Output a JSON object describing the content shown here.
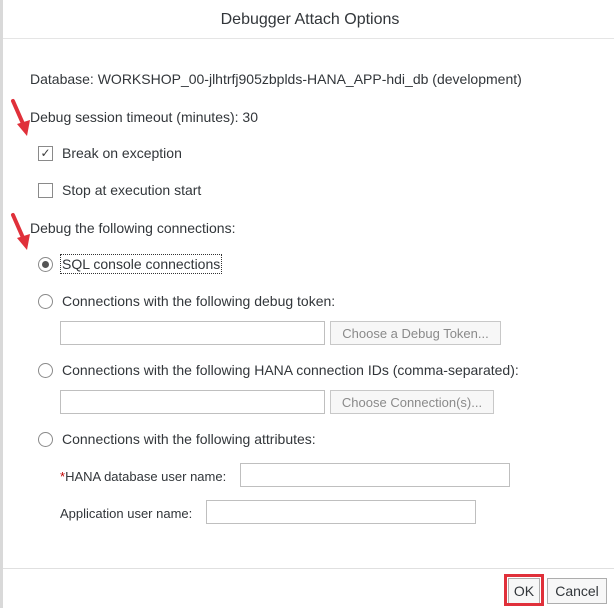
{
  "dialog": {
    "title": "Debugger Attach Options",
    "database_text": "Database: WORKSHOP_00-jlhtrfj905zbplds-HANA_APP-hdi_db (development)",
    "timeout_text": "Debug session timeout (minutes): 30",
    "options": {
      "break_on_exception": {
        "label": "Break on exception",
        "checked": true
      },
      "stop_at_start": {
        "label": "Stop at execution start",
        "checked": false
      }
    },
    "connections_heading": "Debug the following connections:",
    "connections": {
      "sql_console": {
        "label": "SQL console connections",
        "selected": true
      },
      "debug_token": {
        "label": "Connections with the following debug token:",
        "selected": false,
        "input_value": "",
        "button_label": "Choose a Debug Token..."
      },
      "hana_ids": {
        "label": "Connections with the following HANA connection IDs (comma-separated):",
        "selected": false,
        "input_value": "",
        "button_label": "Choose Connection(s)..."
      },
      "attributes": {
        "label": "Connections with the following attributes:",
        "selected": false,
        "required_marker": "*",
        "hana_user_label": "HANA database user name:",
        "hana_user_value": "",
        "app_user_label": "Application user name:",
        "app_user_value": ""
      }
    },
    "footer": {
      "ok_label": "OK",
      "cancel_label": "Cancel"
    }
  },
  "colors": {
    "annotation": "#e0303a",
    "border": "#bfbfbf"
  }
}
